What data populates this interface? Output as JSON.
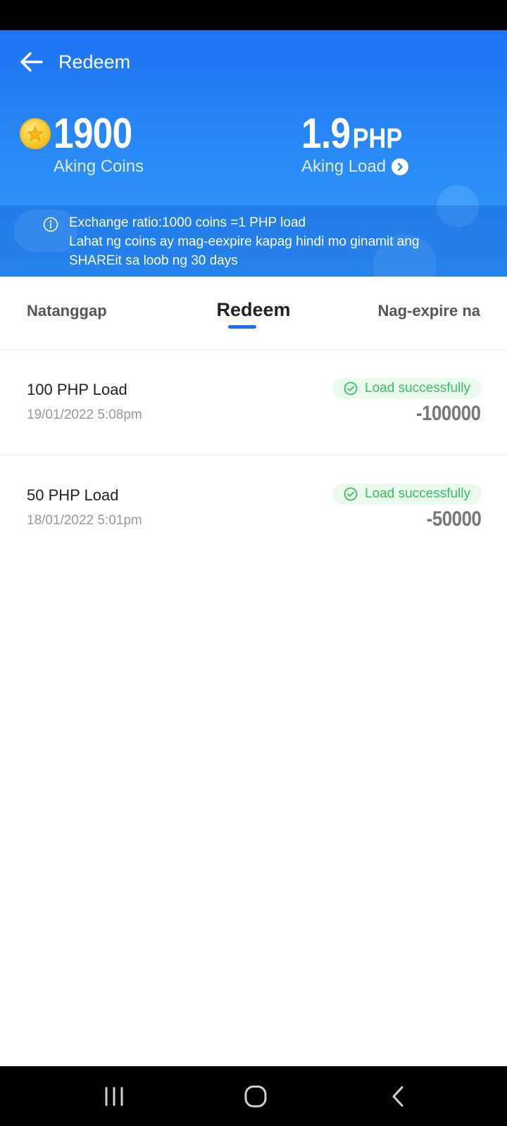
{
  "header": {
    "title": "Redeem",
    "coins": {
      "value": "1900",
      "label": "Aking Coins"
    },
    "load": {
      "value": "1.9",
      "unit": "PHP",
      "label": "Aking Load"
    },
    "info": {
      "lines": [
        "Exchange ratio:1000 coins =1 PHP load",
        "Lahat ng coins ay mag-eexpire kapag hindi mo ginamit ang",
        "SHAREit sa loob ng 30 days"
      ]
    }
  },
  "tabs": {
    "received": "Natanggap",
    "redeem": "Redeem",
    "expired": "Nag-expire na",
    "active": "redeem"
  },
  "items": [
    {
      "title": "100 PHP Load",
      "date": "19/01/2022 5:08pm",
      "status": "Load successfully",
      "amount": "-100000"
    },
    {
      "title": "50 PHP Load",
      "date": "18/01/2022 5:01pm",
      "status": "Load successfully",
      "amount": "-50000"
    }
  ],
  "colors": {
    "header_blue": "#1e73f3",
    "success_green": "#3bbf62",
    "tab_indicator": "#1f6ff0"
  },
  "icons": {
    "back": "arrow-left-icon",
    "coin": "coin-icon",
    "load_link": "chevron-right-circle-icon",
    "info": "info-icon",
    "status": "check-circle-icon",
    "nav_recent": "recent-apps-icon",
    "nav_home": "home-icon",
    "nav_back": "back-icon"
  }
}
